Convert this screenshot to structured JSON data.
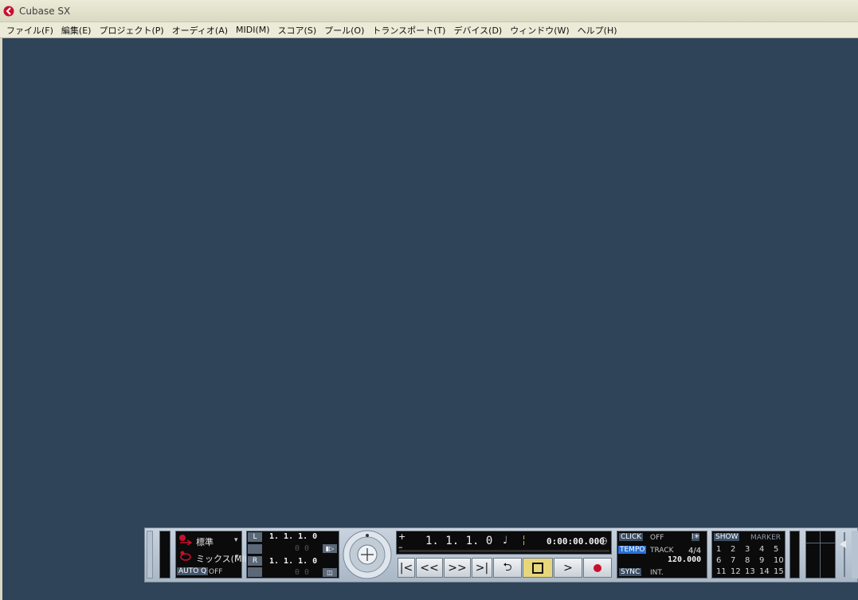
{
  "window": {
    "title": "Cubase SX"
  },
  "menu": [
    {
      "label": "ファイル(F)"
    },
    {
      "label": "編集(E)"
    },
    {
      "label": "プロジェクト(P)"
    },
    {
      "label": "オーディオ(A)"
    },
    {
      "label": "MIDI(M)"
    },
    {
      "label": "スコア(S)"
    },
    {
      "label": "プール(O)"
    },
    {
      "label": "トランスポート(T)"
    },
    {
      "label": "デバイス(D)"
    },
    {
      "label": "ウィンドウ(W)"
    },
    {
      "label": "ヘルプ(H)"
    }
  ],
  "transport": {
    "record_mode": "標準",
    "cycle_mode": "ミックス(MII",
    "auto_q_label": "AUTO Q",
    "auto_q_value": "OFF",
    "left_locator_label": "L",
    "right_locator_label": "R",
    "left_locator": "1. 1. 1.    0",
    "left_sub": "0.    0",
    "right_locator": "1. 1. 1.    0",
    "right_sub": "0    0",
    "position_bars": "1.  1.  1.    0",
    "position_time": "0:00:00.000",
    "click_label": "CLICK",
    "click_value": "OFF",
    "tempo_label": "TEMPO",
    "tempo_mode": "TRACK",
    "signature": "4/4",
    "tempo_value": "120.000",
    "sync_label": "SYNC",
    "sync_value": "INT.",
    "show_label": "SHOW",
    "marker_label": "MARKER",
    "markers_row1": [
      "1",
      "2",
      "3",
      "4",
      "5"
    ],
    "markers_row2": [
      "6",
      "7",
      "8",
      "9",
      "10"
    ],
    "markers_row3": [
      "11",
      "12",
      "13",
      "14",
      "15"
    ]
  },
  "colors": {
    "workspace": "#2f4459",
    "stop_active": "#e8d77a",
    "record": "#c8102e"
  }
}
